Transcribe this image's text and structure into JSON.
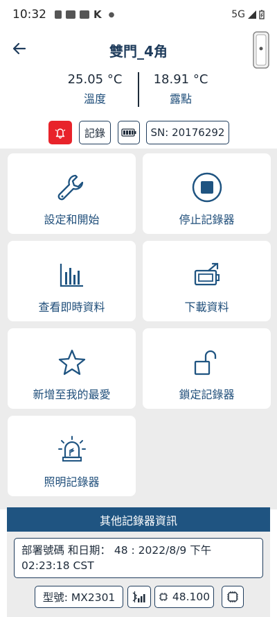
{
  "status_bar": {
    "time": "10:32",
    "network": "5G"
  },
  "app_bar": {
    "title": "雙門_4角"
  },
  "readings": {
    "temperature_value": "25.05 °C",
    "temperature_label": "溫度",
    "dewpoint_value": "18.91 °C",
    "dewpoint_label": "露點"
  },
  "chips": {
    "log_label": "記錄",
    "sn_label": "SN: 20176292"
  },
  "tiles": [
    {
      "label": "設定和開始",
      "icon": "wrench-icon"
    },
    {
      "label": "停止記錄器",
      "icon": "stop-icon"
    },
    {
      "label": "查看即時資料",
      "icon": "bar-chart-icon"
    },
    {
      "label": "下載資料",
      "icon": "download-device-icon"
    },
    {
      "label": "新增至我的最愛",
      "icon": "star-icon"
    },
    {
      "label": "鎖定記錄器",
      "icon": "unlock-icon"
    },
    {
      "label": "照明記錄器",
      "icon": "light-icon"
    }
  ],
  "info_section": {
    "header": "其他記錄器資訊",
    "deploy_line1": "部署號碼 和日期： 48 : 2022/8/9 下午",
    "deploy_line2": "02:23:18 CST",
    "model": "型號: MX2301",
    "firmware": "48.100"
  },
  "colors": {
    "primary": "#1f5481",
    "text_blue": "#1f4e7a",
    "alarm": "#e8232a",
    "grid_bg": "#ececec"
  }
}
